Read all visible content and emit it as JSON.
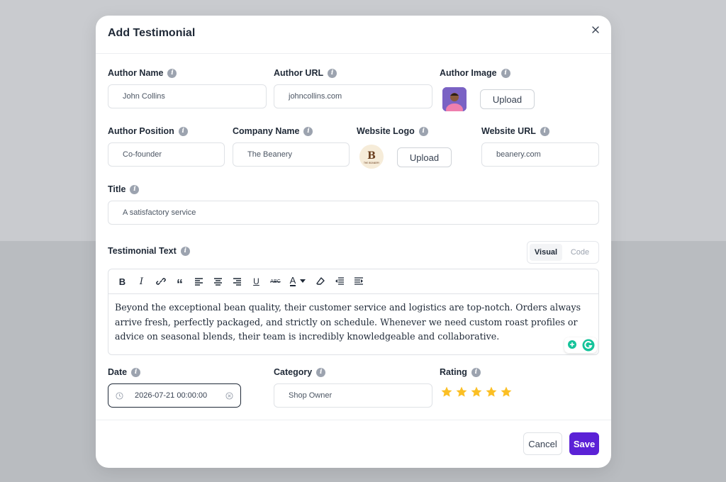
{
  "modal": {
    "title": "Add Testimonial"
  },
  "fields": {
    "author_name": {
      "label": "Author Name",
      "value": "John Collins"
    },
    "author_url": {
      "label": "Author URL",
      "value": "johncollins.com"
    },
    "author_image": {
      "label": "Author Image",
      "upload_label": "Upload"
    },
    "author_position": {
      "label": "Author Position",
      "value": "Co-founder"
    },
    "company_name": {
      "label": "Company Name",
      "value": "The Beanery"
    },
    "website_logo": {
      "label": "Website Logo",
      "upload_label": "Upload"
    },
    "website_url": {
      "label": "Website URL",
      "value": "beanery.com"
    },
    "title": {
      "label": "Title",
      "value": "A satisfactory service"
    },
    "testimonial_text": {
      "label": "Testimonial Text",
      "value": "Beyond the exceptional bean quality, their customer service and logistics are top-notch. Orders always arrive fresh, perfectly packaged, and strictly on schedule. Whenever we need custom roast profiles or advice on seasonal blends, their team is incredibly knowledgeable and collaborative."
    },
    "date": {
      "label": "Date",
      "value": "2026-07-21 00:00:00"
    },
    "category": {
      "label": "Category",
      "value": "Shop Owner"
    },
    "rating": {
      "label": "Rating",
      "value": 5,
      "max": 5
    }
  },
  "editor_modes": {
    "visual": "Visual",
    "code": "Code",
    "active": "Visual"
  },
  "toolbar_icons": [
    "bold-icon",
    "italic-icon",
    "link-icon",
    "quote-icon",
    "align-left-icon",
    "align-center-icon",
    "align-right-icon",
    "underline-icon",
    "strikethrough-icon",
    "text-color-icon",
    "clear-format-icon",
    "outdent-icon",
    "indent-icon"
  ],
  "logo_text": "THE BEANERY",
  "buttons": {
    "cancel": "Cancel",
    "save": "Save"
  },
  "colors": {
    "primary": "#5b21d6",
    "star": "#fbbf24",
    "grammarly": "#15c39a"
  }
}
